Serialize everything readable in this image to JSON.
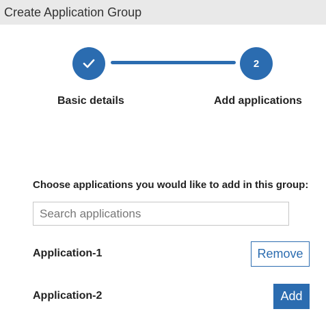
{
  "header": {
    "title": "Create Application Group"
  },
  "stepper": {
    "steps": [
      {
        "label": "Basic details",
        "state": "completed",
        "icon": "check-icon"
      },
      {
        "label": "Add applications",
        "state": "active",
        "number": "2"
      }
    ],
    "accent_color": "#2b6cb0"
  },
  "main": {
    "prompt": "Choose applications you would like to add in this group:",
    "search": {
      "placeholder": "Search applications",
      "value": ""
    },
    "applications": [
      {
        "name": "Application-1",
        "action_label": "Remove"
      },
      {
        "name": "Application-2",
        "action_label": "Add"
      }
    ]
  }
}
